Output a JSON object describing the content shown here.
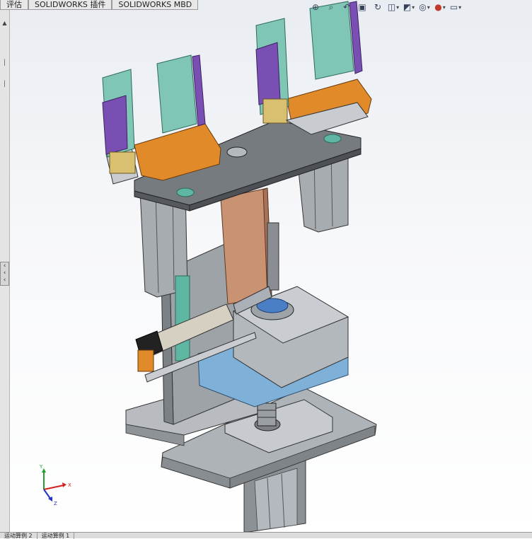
{
  "command_manager": {
    "tabs": [
      {
        "label": "评估"
      },
      {
        "label": "SOLIDWORKS 插件"
      },
      {
        "label": "SOLIDWORKS MBD"
      }
    ]
  },
  "heads_up_toolbar": {
    "buttons": [
      {
        "icon": "zoom-to-fit-icon"
      },
      {
        "icon": "zoom-to-area-icon"
      },
      {
        "icon": "previous-view-icon"
      },
      {
        "icon": "section-view-icon"
      },
      {
        "icon": "dynamic-annotation-icon"
      },
      {
        "icon": "view-orientation-icon"
      },
      {
        "icon": "display-style-icon"
      },
      {
        "icon": "hide-show-items-icon"
      },
      {
        "icon": "edit-appearance-icon"
      },
      {
        "icon": "apply-scene-icon"
      },
      {
        "icon": "view-settings-icon"
      }
    ]
  },
  "triad": {
    "x_label": "X",
    "y_label": "Y",
    "z_label": "Z",
    "colors": {
      "x": "#d42020",
      "y": "#1fa02c",
      "z": "#2432c8"
    }
  },
  "bottom_tabs": [
    {
      "label": "运动算例 2"
    },
    {
      "label": "运动算例 1"
    }
  ],
  "colors": {
    "plate_gray": "#8a8e92",
    "steel": "#a8adb3",
    "orange": "#e08a2a",
    "purple": "#7a4fb4",
    "teal": "#7fc6b6",
    "copper": "#c99272",
    "blue_block": "#7fb0d8"
  }
}
